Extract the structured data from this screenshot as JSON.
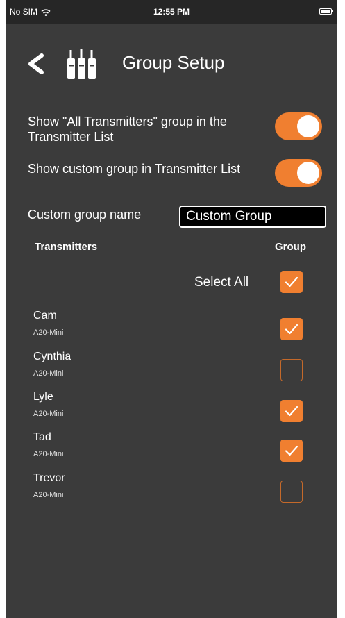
{
  "status_bar": {
    "carrier": "No SIM",
    "time": "12:55 PM"
  },
  "header": {
    "title": "Group Setup"
  },
  "options": [
    {
      "label": "Show \"All Transmitters\" group in the Transmitter List",
      "enabled": true
    },
    {
      "label": "Show custom group in Transmitter List",
      "enabled": true
    }
  ],
  "custom_group": {
    "label": "Custom group name",
    "value": "Custom Group"
  },
  "table": {
    "col_transmitters": "Transmitters",
    "col_group": "Group",
    "select_all_label": "Select All",
    "select_all_checked": true
  },
  "transmitters": [
    {
      "name": "Cam",
      "model": "A20-Mini",
      "checked": true
    },
    {
      "name": "Cynthia",
      "model": "A20-Mini",
      "checked": false
    },
    {
      "name": "Lyle",
      "model": "A20-Mini",
      "checked": true
    },
    {
      "name": "Tad",
      "model": "A20-Mini",
      "checked": true
    },
    {
      "name": "Trevor",
      "model": "A20-Mini",
      "checked": false
    }
  ],
  "colors": {
    "accent": "#f07f30",
    "background": "#3b3b3b"
  }
}
